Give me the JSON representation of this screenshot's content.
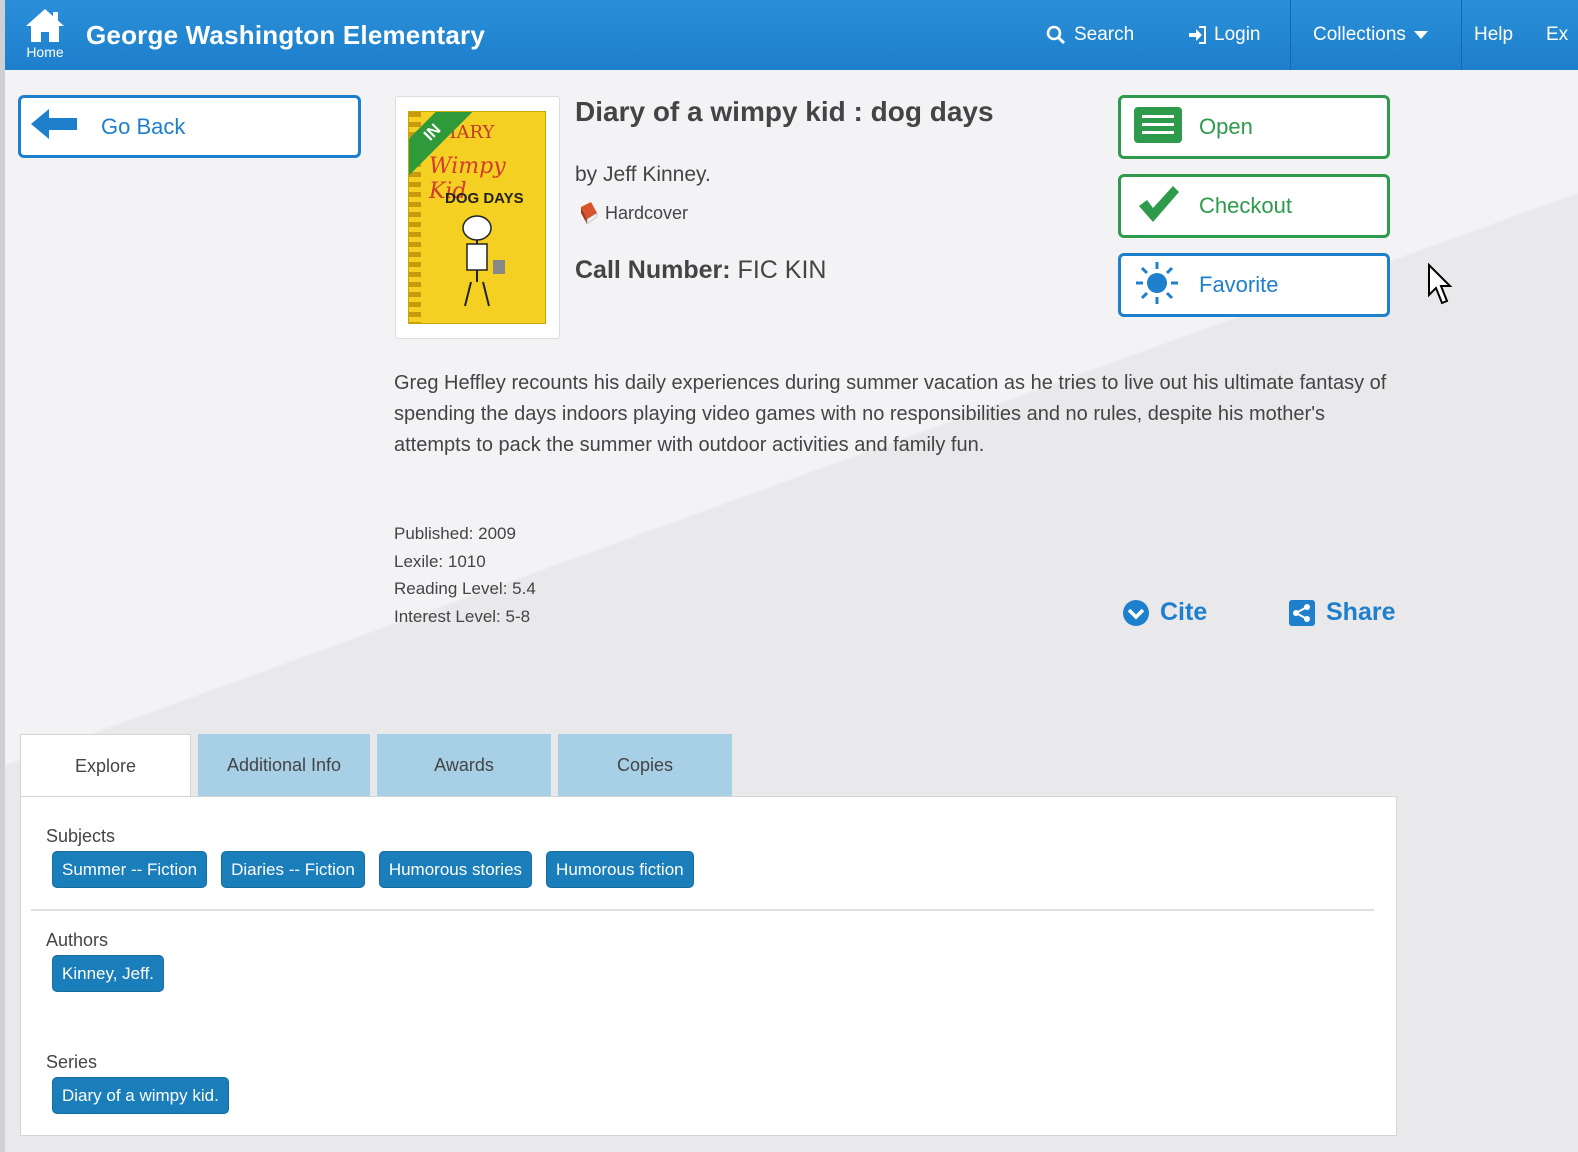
{
  "header": {
    "home_label": "Home",
    "school_name": "George Washington Elementary",
    "nav": {
      "search": "Search",
      "login": "Login",
      "collections": "Collections",
      "help": "Help",
      "ex": "Ex"
    }
  },
  "actions": {
    "go_back": "Go Back",
    "open": "Open",
    "checkout": "Checkout",
    "favorite": "Favorite",
    "cite": "Cite",
    "share": "Share"
  },
  "book": {
    "title": "Diary of a wimpy kid : dog days",
    "byline": "by Jeff Kinney.",
    "format": "Hardcover",
    "call_number_label": "Call Number:",
    "call_number": "FIC KIN",
    "cover": {
      "badge": "IN",
      "line1": "DIARY",
      "line2": "Wimpy Kid",
      "line3": "DOG DAYS"
    },
    "description": "Greg Heffley recounts his daily experiences during summer vacation as he tries to live out his ultimate fantasy of spending the days indoors playing video games with no responsibilities and no rules, despite his mother's attempts to pack the summer with outdoor activities and family fun.",
    "published": "Published: 2009",
    "lexile": "Lexile: 1010",
    "reading_level": "Reading Level: 5.4",
    "interest_level": "Interest Level: 5-8"
  },
  "tabs": [
    {
      "label": "Explore"
    },
    {
      "label": "Additional Info"
    },
    {
      "label": "Awards"
    },
    {
      "label": "Copies"
    }
  ],
  "explore": {
    "subjects_label": "Subjects",
    "subjects": [
      "Summer -- Fiction",
      "Diaries -- Fiction",
      "Humorous stories",
      "Humorous fiction"
    ],
    "authors_label": "Authors",
    "authors": [
      "Kinney, Jeff."
    ],
    "series_label": "Series",
    "series": [
      "Diary of a wimpy kid."
    ]
  },
  "colors": {
    "brand_blue": "#1e7fcc",
    "action_green": "#2e9a4b",
    "chip_blue": "#1a7ebb",
    "tab_inactive": "#a7cfe6"
  }
}
